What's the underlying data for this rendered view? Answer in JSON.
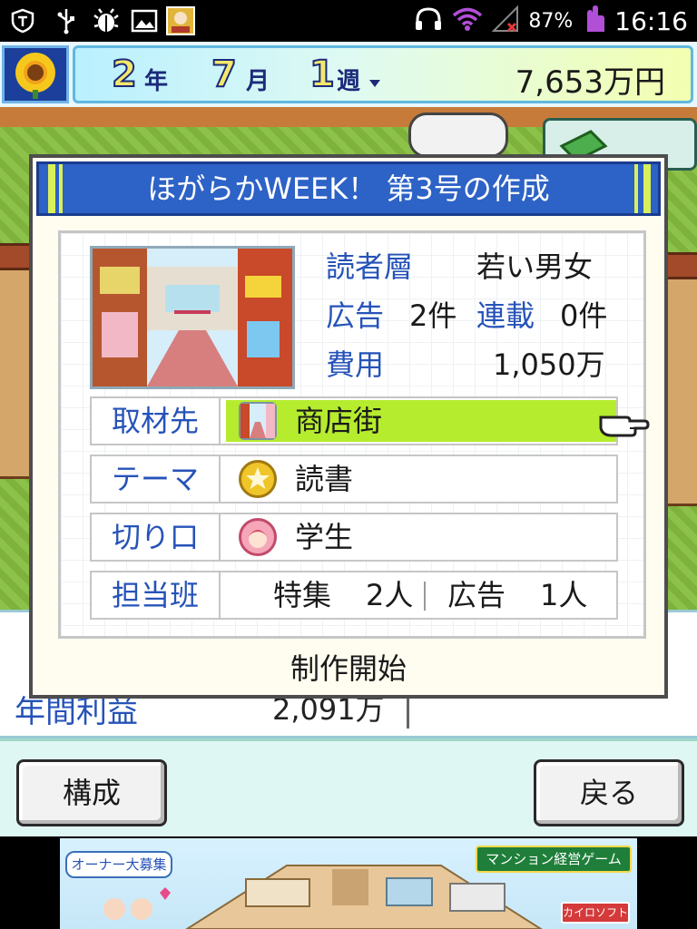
{
  "status_bar": {
    "battery": "87%",
    "clock": "16:16",
    "icons": [
      "shield-app-icon",
      "usb-icon",
      "android-debug-icon",
      "image-icon",
      "game-app-icon",
      "headphones-icon",
      "wifi-icon",
      "signal-off-icon",
      "battery-icon",
      "touch-hand-icon"
    ]
  },
  "header": {
    "season_icon": "sunflower-icon",
    "year": "2",
    "year_unit": "年",
    "month": "7",
    "month_unit": "月",
    "week": "1",
    "week_unit": "週",
    "money": "7,653万円"
  },
  "dialog": {
    "title": "ほがらかWEEK！ 第3号の作成",
    "readers_label": "読者層",
    "readers_value": "若い男女",
    "ads_label": "広告",
    "ads_value": "2件",
    "serial_label": "連載",
    "serial_value": "0件",
    "cost_label": "費用",
    "cost_value": "1,050万",
    "rows": [
      {
        "label": "取材先",
        "value": "商店街",
        "icon": "shopping-street-icon",
        "selected": true
      },
      {
        "label": "テーマ",
        "value": "読書",
        "icon": "gold-star-medal-icon",
        "selected": false
      },
      {
        "label": "切り口",
        "value": "学生",
        "icon": "student-face-icon",
        "selected": false
      }
    ],
    "team": {
      "label": "担当班",
      "feature_label": "特集",
      "feature_count": "2人",
      "ad_label": "広告",
      "ad_count": "1人"
    },
    "start_label": "制作開始"
  },
  "background_panel": {
    "label": "年間利益",
    "value": "2,091万"
  },
  "actions": {
    "compose_label": "構成",
    "back_label": "戻る"
  },
  "ad": {
    "badge": "オーナー大募集",
    "title": "マンション経営ゲーム",
    "brand": "カイロソフト"
  },
  "colors": {
    "title_bar": "#2d62c6",
    "label_blue": "#2653b8",
    "selected_row": "#b6ec2e",
    "dialog_bg": "#fffdf0"
  }
}
